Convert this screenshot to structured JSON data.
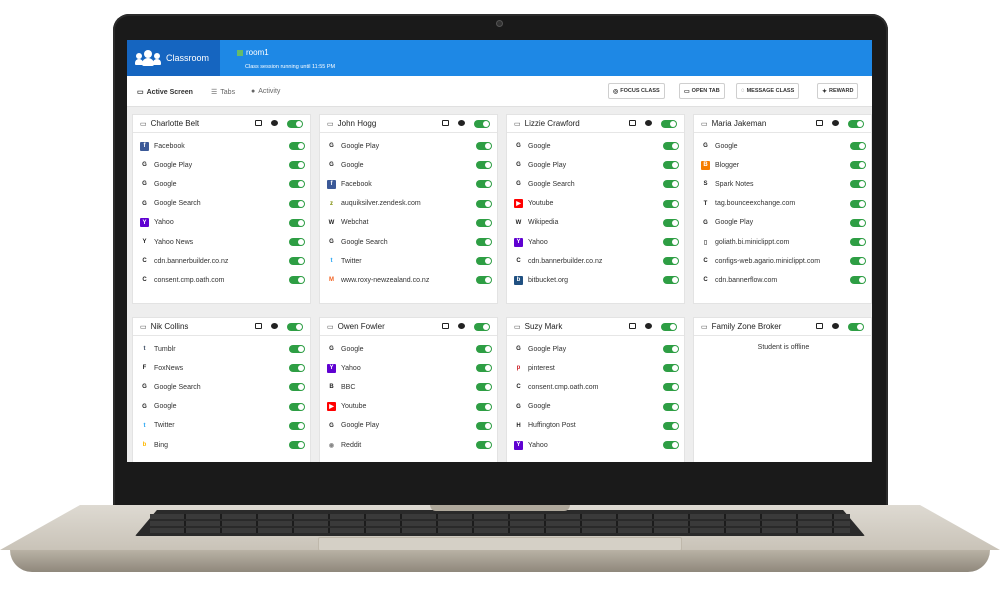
{
  "header": {
    "brand": "Classroom",
    "room": "room1",
    "session": "Class session running until 11:55 PM"
  },
  "tabs": [
    {
      "label": "Active Screen",
      "icon": "monitor-icon"
    },
    {
      "label": "Tabs",
      "icon": "list-icon"
    },
    {
      "label": "Activity",
      "icon": "dot-icon"
    }
  ],
  "actions": [
    {
      "label": "FOCUS CLASS",
      "icon": "target-icon"
    },
    {
      "label": "OPEN TAB",
      "icon": "window-icon"
    },
    {
      "label": "MESSAGE CLASS",
      "icon": "chat-icon"
    },
    {
      "label": "REWARD",
      "icon": "gift-icon"
    }
  ],
  "students": [
    {
      "name": "Charlotte Belt",
      "sites": [
        {
          "label": "Facebook",
          "icon": "facebook-icon"
        },
        {
          "label": "Google Play",
          "icon": "google-icon"
        },
        {
          "label": "Google",
          "icon": "google-icon"
        },
        {
          "label": "Google Search",
          "icon": "google-icon"
        },
        {
          "label": "Yahoo",
          "icon": "yahoo-icon"
        },
        {
          "label": "Yahoo News",
          "icon": "yahoo-news-icon"
        },
        {
          "label": "cdn.bannerbuilder.co.nz",
          "icon": "letter-c-icon"
        },
        {
          "label": "consent.cmp.oath.com",
          "icon": "letter-c-icon"
        }
      ]
    },
    {
      "name": "John Hogg",
      "sites": [
        {
          "label": "Google Play",
          "icon": "google-icon"
        },
        {
          "label": "Google",
          "icon": "google-icon"
        },
        {
          "label": "Facebook",
          "icon": "facebook-icon"
        },
        {
          "label": "auquiksilver.zendesk.com",
          "icon": "zendesk-icon"
        },
        {
          "label": "Webchat",
          "icon": "letter-w-icon"
        },
        {
          "label": "Google Search",
          "icon": "google-icon"
        },
        {
          "label": "Twitter",
          "icon": "twitter-icon"
        },
        {
          "label": "www.roxy-newzealand.co.nz",
          "icon": "magento-icon"
        }
      ]
    },
    {
      "name": "Lizzie Crawford",
      "sites": [
        {
          "label": "Google",
          "icon": "google-icon"
        },
        {
          "label": "Google Play",
          "icon": "google-icon"
        },
        {
          "label": "Google Search",
          "icon": "google-icon"
        },
        {
          "label": "Youtube",
          "icon": "youtube-icon"
        },
        {
          "label": "Wikipedia",
          "icon": "wikipedia-icon"
        },
        {
          "label": "Yahoo",
          "icon": "yahoo-icon"
        },
        {
          "label": "cdn.bannerbuilder.co.nz",
          "icon": "letter-c-icon"
        },
        {
          "label": "bitbucket.org",
          "icon": "bitbucket-icon"
        }
      ]
    },
    {
      "name": "Maria Jakeman",
      "sites": [
        {
          "label": "Google",
          "icon": "google-icon"
        },
        {
          "label": "Blogger",
          "icon": "blogger-icon"
        },
        {
          "label": "Spark Notes",
          "icon": "letter-s-icon"
        },
        {
          "label": "tag.bounceexchange.com",
          "icon": "letter-t-icon"
        },
        {
          "label": "Google Play",
          "icon": "google-icon"
        },
        {
          "label": "goliath.bi.miniclippt.com",
          "icon": "doc-icon"
        },
        {
          "label": "configs-web.agario.miniclippt.com",
          "icon": "letter-c-icon"
        },
        {
          "label": "cdn.bannerflow.com",
          "icon": "letter-c-icon"
        }
      ]
    },
    {
      "name": "Nik Collins",
      "sites": [
        {
          "label": "Tumblr",
          "icon": "tumblr-icon"
        },
        {
          "label": "FoxNews",
          "icon": "letter-f-icon"
        },
        {
          "label": "Google Search",
          "icon": "google-icon"
        },
        {
          "label": "Google",
          "icon": "google-icon"
        },
        {
          "label": "Twitter",
          "icon": "twitter-icon"
        },
        {
          "label": "Bing",
          "icon": "bing-icon"
        }
      ]
    },
    {
      "name": "Owen Fowler",
      "sites": [
        {
          "label": "Google",
          "icon": "google-icon"
        },
        {
          "label": "Yahoo",
          "icon": "yahoo-icon"
        },
        {
          "label": "BBC",
          "icon": "letter-b-icon"
        },
        {
          "label": "Youtube",
          "icon": "youtube-icon"
        },
        {
          "label": "Google Play",
          "icon": "google-icon"
        },
        {
          "label": "Reddit",
          "icon": "reddit-icon"
        }
      ]
    },
    {
      "name": "Suzy Mark",
      "sites": [
        {
          "label": "Google Play",
          "icon": "google-icon"
        },
        {
          "label": "pinterest",
          "icon": "pinterest-icon"
        },
        {
          "label": "consent.cmp.oath.com",
          "icon": "letter-c-icon"
        },
        {
          "label": "Google",
          "icon": "google-icon"
        },
        {
          "label": "Huffington Post",
          "icon": "letter-h-icon"
        },
        {
          "label": "Yahoo",
          "icon": "yahoo-icon"
        }
      ]
    },
    {
      "name": "Family Zone Broker",
      "offline": "Student is offline",
      "sites": []
    }
  ],
  "colors": {
    "header": "#1e88e5",
    "brand": "#1565c0",
    "toggle": "#2e9e44"
  }
}
